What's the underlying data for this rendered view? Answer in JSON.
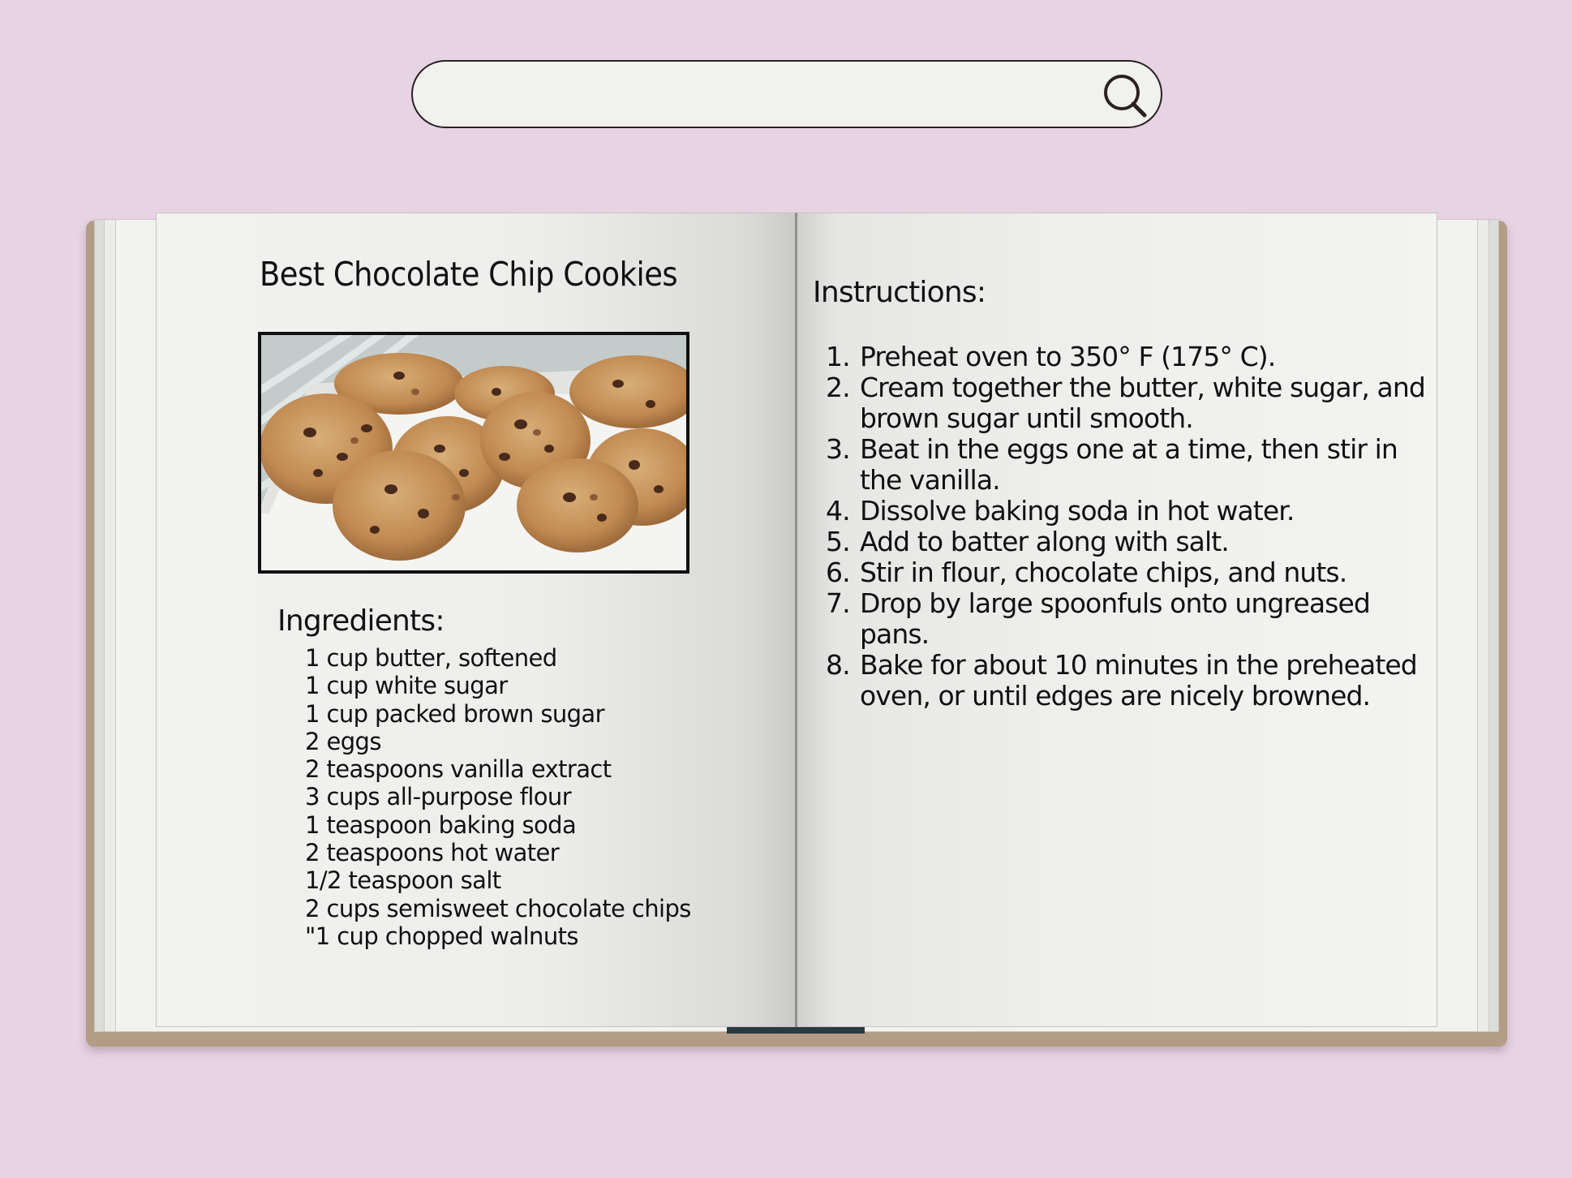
{
  "search": {
    "value": "",
    "placeholder": ""
  },
  "recipe": {
    "title": "Best Chocolate Chip Cookies",
    "ingredients_heading": "Ingredients:",
    "ingredients": [
      "1 cup butter, softened",
      "1 cup white sugar",
      "1 cup packed brown sugar",
      "2 eggs",
      "2 teaspoons vanilla extract",
      "3 cups all-purpose flour",
      "1 teaspoon baking soda",
      "2 teaspoons hot water",
      "1/2 teaspoon salt",
      "2 cups semisweet chocolate chips",
      "\"1 cup chopped walnuts"
    ],
    "instructions_heading": "Instructions:",
    "instructions": [
      {
        "num": "1.",
        "text": "Preheat oven to 350° F (175° C)."
      },
      {
        "num": "2.",
        "text": "Cream together the butter, white sugar, and brown sugar until smooth."
      },
      {
        "num": "3.",
        "text": "Beat in the eggs one at a time, then stir in the vanilla."
      },
      {
        "num": "4.",
        "text": "Dissolve baking soda in hot water."
      },
      {
        "num": "5.",
        "text": "Add to batter along with salt."
      },
      {
        "num": "6.",
        "text": "Stir in flour, chocolate chips, and nuts."
      },
      {
        "num": "7.",
        "text": "Drop by large spoonfuls onto ungreased pans."
      },
      {
        "num": "8.",
        "text": "Bake for about 10 minutes in the preheated oven, or until edges are nicely browned."
      }
    ]
  },
  "icons": {
    "search": "search-icon"
  },
  "colors": {
    "background": "#e6d3e4",
    "search_bar": "#f1f2f0",
    "book_cover": "#b29c86",
    "page": "#f2f2f0",
    "bookmark": "#2a3b40"
  }
}
